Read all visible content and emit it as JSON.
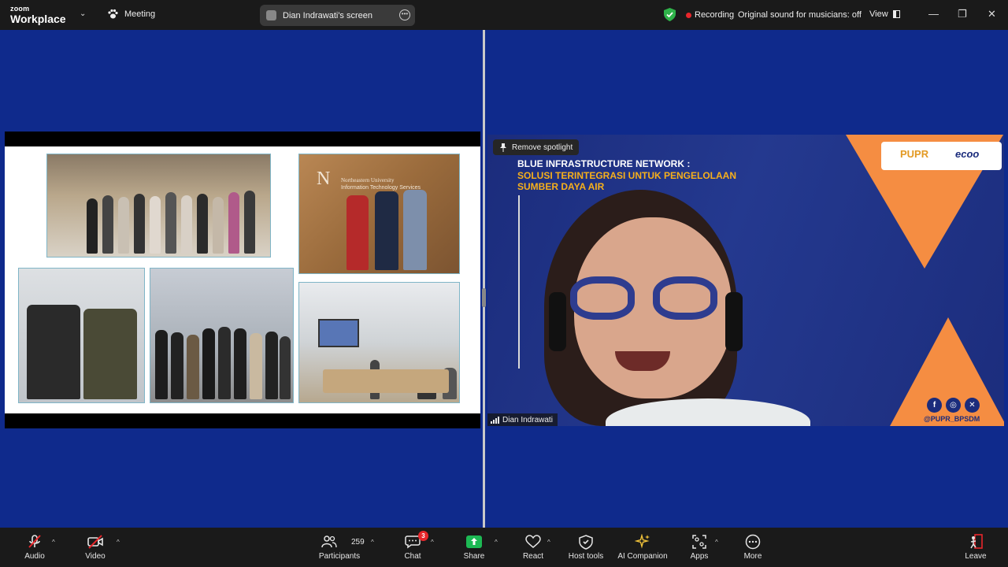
{
  "app": {
    "logo_line1": "zoom",
    "logo_line2": "Workplace",
    "meeting_label": "Meeting",
    "screen_share_label": "Dian Indrawati's screen",
    "recording_label": "Recording",
    "original_sound_label": "Original sound for musicians: off",
    "view_label": "View"
  },
  "shared_slide": {
    "sign_letter": "N",
    "sign_line1": "Northeastern University",
    "sign_line2": "Information Technology Services"
  },
  "speaker": {
    "remove_spotlight_label": "Remove spotlight",
    "name": "Dian Indrawati",
    "background": {
      "title_line1": "BLUE INFRASTRUCTURE NETWORK :",
      "title_line2": "SOLUSI TERINTEGRASI UNTUK PENGELOLAAN",
      "title_line3": "SUMBER DAYA AIR",
      "logo_pupr": "PUPR",
      "logo_second": "ecoo",
      "handle": "@PUPR_BPSDM",
      "social_f": "f",
      "social_ig": "◎",
      "social_x": "✕"
    }
  },
  "toolbar": {
    "audio": "Audio",
    "video": "Video",
    "participants": "Participants",
    "participants_count": "259",
    "chat": "Chat",
    "chat_badge": "3",
    "share": "Share",
    "react": "React",
    "host_tools": "Host tools",
    "ai_companion": "AI Companion",
    "apps": "Apps",
    "more": "More",
    "leave": "Leave"
  },
  "colors": {
    "meeting_bg": "#0f2a8c",
    "bar_bg": "#1a1a1a",
    "recording_red": "#e8262b",
    "share_green": "#1db954",
    "accent_orange": "#f58d42"
  }
}
